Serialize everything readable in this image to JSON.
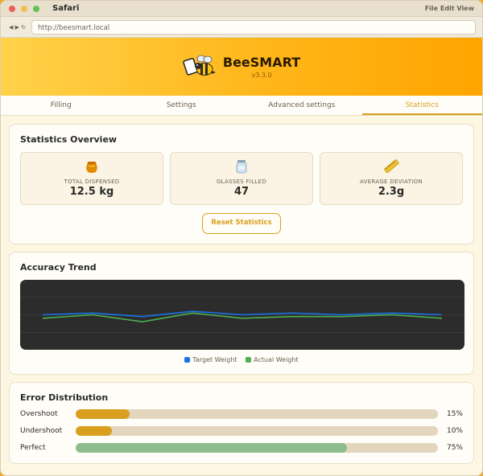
{
  "window": {
    "app_name": "Safari",
    "menu": "File  Edit  View"
  },
  "browser": {
    "url": "http://beesmart.local",
    "nav": "◀ ▶ ↻"
  },
  "header": {
    "title": "BeeSMART",
    "version": "v3.3.0"
  },
  "tabs": [
    {
      "label": "Filling",
      "active": false
    },
    {
      "label": "Settings",
      "active": false
    },
    {
      "label": "Advanced settings",
      "active": false
    },
    {
      "label": "Statistics",
      "active": true
    }
  ],
  "overview": {
    "title": "Statistics Overview",
    "stats": [
      {
        "icon": "honey-pot-icon",
        "label": "TOTAL DISPENSED",
        "value": "12.5 kg"
      },
      {
        "icon": "jar-icon",
        "label": "GLASSES FILLED",
        "value": "47"
      },
      {
        "icon": "ruler-icon",
        "label": "AVERAGE DEVIATION",
        "value": "2.3g"
      }
    ],
    "reset_label": "Reset Statistics"
  },
  "trend": {
    "title": "Accuracy Trend",
    "legend": {
      "target": "Target Weight",
      "actual": "Actual Weight"
    },
    "colors": {
      "target": "#1a73e8",
      "actual": "#4caf50"
    }
  },
  "chart_data": {
    "type": "line",
    "x": [
      0,
      1,
      2,
      3,
      4,
      5,
      6,
      7,
      8
    ],
    "series": [
      {
        "name": "Target Weight",
        "values": [
          500,
          501,
          499,
          502,
          500,
          501,
          500,
          501,
          500
        ]
      },
      {
        "name": "Actual Weight",
        "values": [
          498,
          500,
          496,
          501,
          498,
          499,
          499,
          500,
          498
        ]
      }
    ],
    "ylim": [
      480,
      520
    ],
    "grid": true,
    "legend": "bottom"
  },
  "distribution": {
    "title": "Error Distribution",
    "rows": [
      {
        "label": "Overshoot",
        "pct": "15%",
        "value": 15,
        "color": "#d9a020"
      },
      {
        "label": "Undershoot",
        "pct": "10%",
        "value": 10,
        "color": "#d9a020"
      },
      {
        "label": "Perfect",
        "pct": "75%",
        "value": 75,
        "color": "#8fbc8f"
      }
    ]
  }
}
